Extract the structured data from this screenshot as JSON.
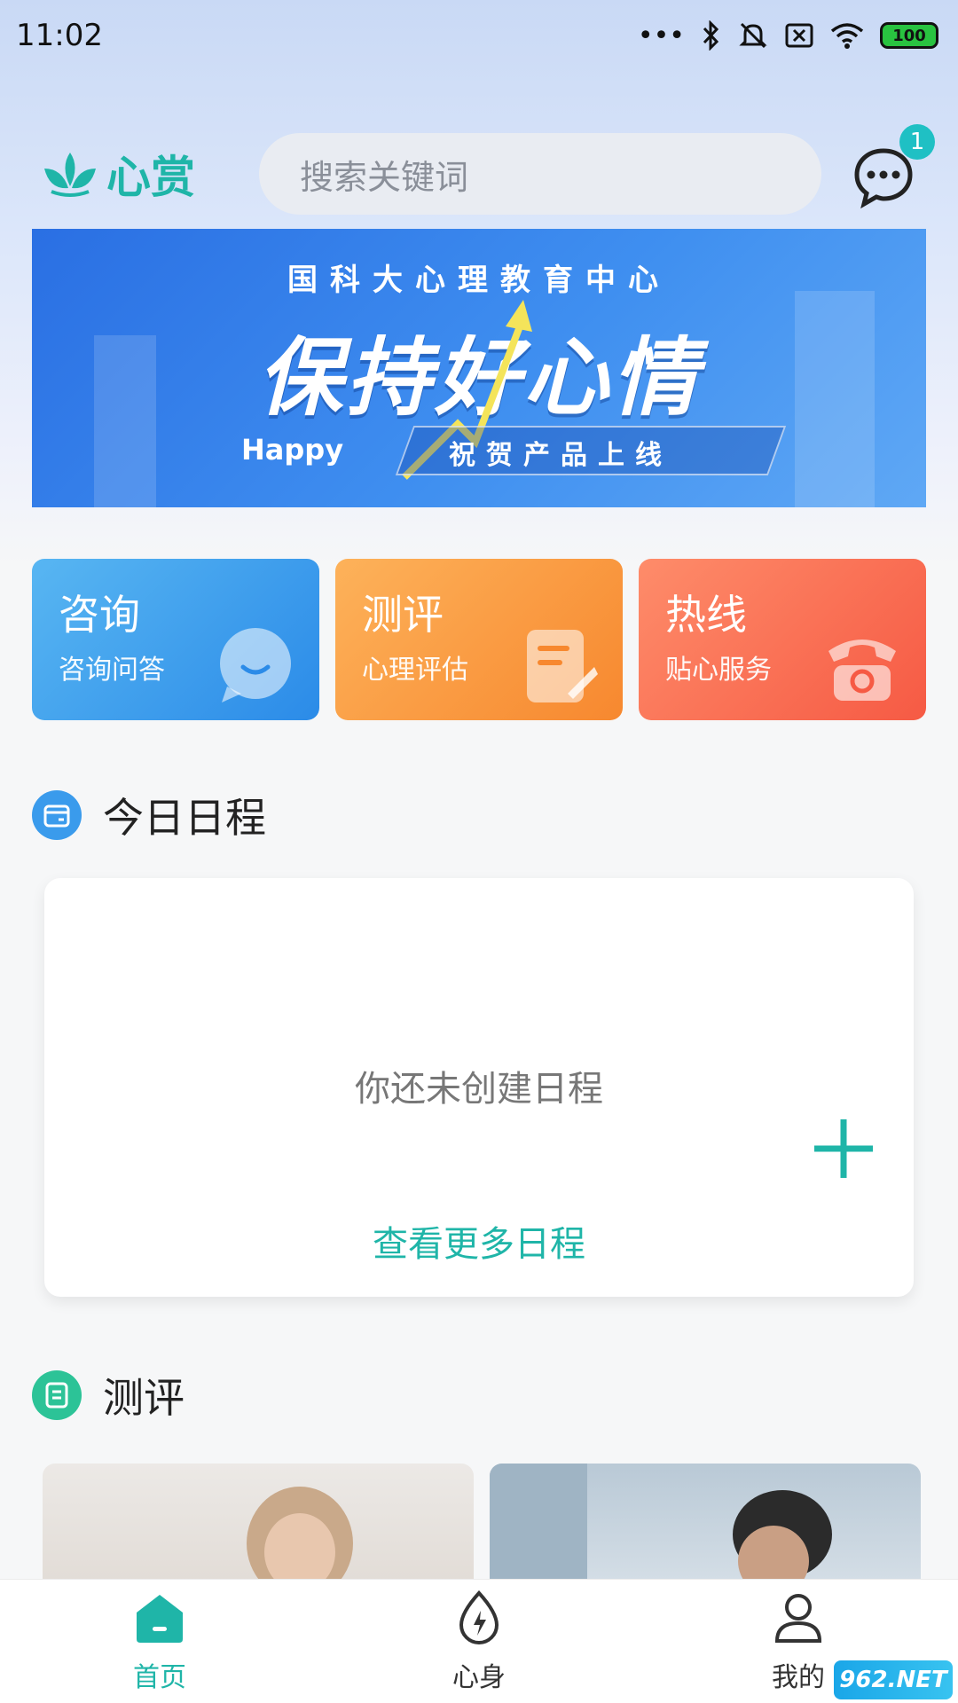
{
  "status_bar": {
    "time": "11:02",
    "battery": "100"
  },
  "header": {
    "logo_text": "心赏",
    "search_placeholder": "搜索关键词",
    "message_badge": "1"
  },
  "banner": {
    "subtitle": "国科大心理教育中心",
    "title": "保持好心情",
    "tag": "Happy",
    "ribbon": "祝贺产品上线"
  },
  "quick_entries": [
    {
      "title": "咨询",
      "subtitle": "咨询问答",
      "icon": "chat-bubble-icon"
    },
    {
      "title": "测评",
      "subtitle": "心理评估",
      "icon": "document-edit-icon"
    },
    {
      "title": "热线",
      "subtitle": "贴心服务",
      "icon": "telephone-icon"
    }
  ],
  "schedule": {
    "section_title": "今日日程",
    "empty_text": "你还未创建日程",
    "more_link": "查看更多日程"
  },
  "assessment": {
    "section_title": "测评"
  },
  "bottom_nav": [
    {
      "label": "首页",
      "icon": "home-icon",
      "active": true
    },
    {
      "label": "心身",
      "icon": "energy-drop-icon",
      "active": false
    },
    {
      "label": "我的",
      "icon": "user-icon",
      "active": false
    }
  ],
  "watermark": "962.NET",
  "colors": {
    "accent": "#1fb5a8",
    "blue_card": "#3a9bec",
    "orange_card": "#f99a3c",
    "red_card": "#f86c50"
  }
}
